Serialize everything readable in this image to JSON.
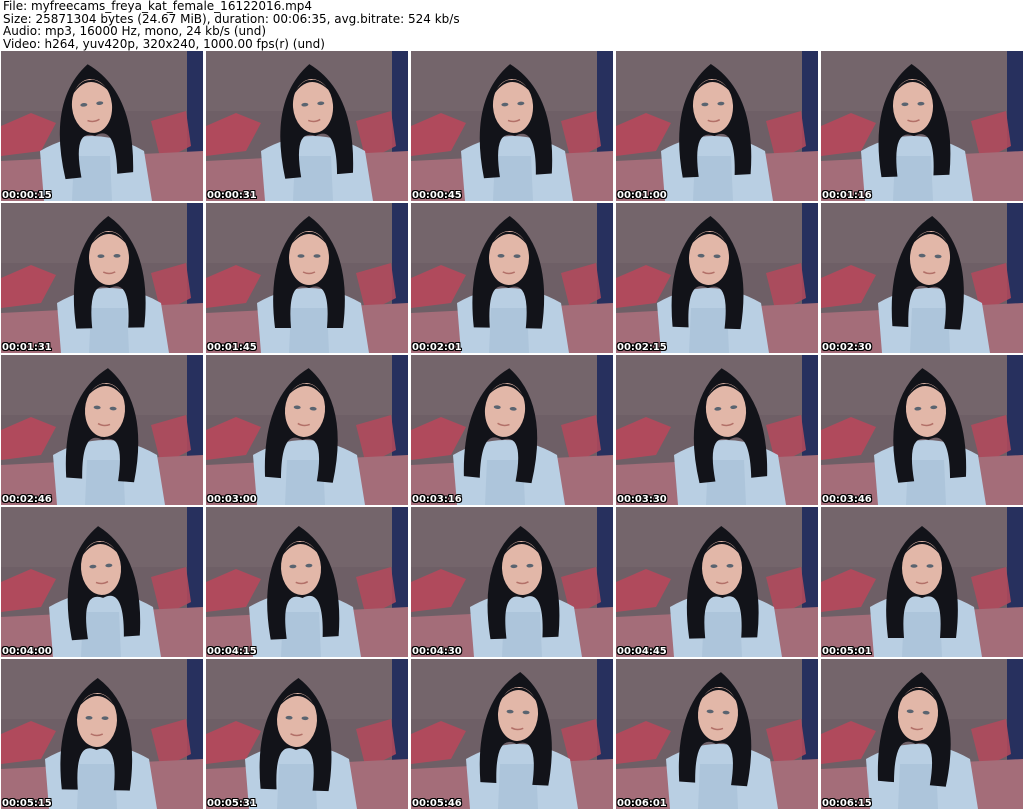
{
  "header": {
    "file_line": "File: myfreecams_freya_kat_female_16122016.mp4",
    "size_line": "Size: 25871304 bytes (24.67 MiB), duration: 00:06:35, avg.bitrate: 524 kb/s",
    "audio_line": "Audio: mp3, 16000 Hz, mono, 24 kb/s (und)",
    "video_line": "Video: h264, yuv420p, 320x240, 1000.00 fps(r) (und)"
  },
  "thumbnails": [
    {
      "timestamp": "00:00:15"
    },
    {
      "timestamp": "00:00:31"
    },
    {
      "timestamp": "00:00:45"
    },
    {
      "timestamp": "00:01:00"
    },
    {
      "timestamp": "00:01:16"
    },
    {
      "timestamp": "00:01:31"
    },
    {
      "timestamp": "00:01:45"
    },
    {
      "timestamp": "00:02:01"
    },
    {
      "timestamp": "00:02:15"
    },
    {
      "timestamp": "00:02:30"
    },
    {
      "timestamp": "00:02:46"
    },
    {
      "timestamp": "00:03:00"
    },
    {
      "timestamp": "00:03:16"
    },
    {
      "timestamp": "00:03:30"
    },
    {
      "timestamp": "00:03:46"
    },
    {
      "timestamp": "00:04:00"
    },
    {
      "timestamp": "00:04:15"
    },
    {
      "timestamp": "00:04:30"
    },
    {
      "timestamp": "00:04:45"
    },
    {
      "timestamp": "00:05:01"
    },
    {
      "timestamp": "00:05:15"
    },
    {
      "timestamp": "00:05:31"
    },
    {
      "timestamp": "00:05:46"
    },
    {
      "timestamp": "00:06:01"
    },
    {
      "timestamp": "00:06:15"
    }
  ],
  "colors": {
    "wall": "#6e5f66",
    "cushion": "#b04a5c",
    "sweater": "#b9cfe3",
    "hair": "#121319",
    "skin": "#e2b7a8",
    "curtain": "#27305e",
    "timestamp_text": "#ffffff"
  }
}
